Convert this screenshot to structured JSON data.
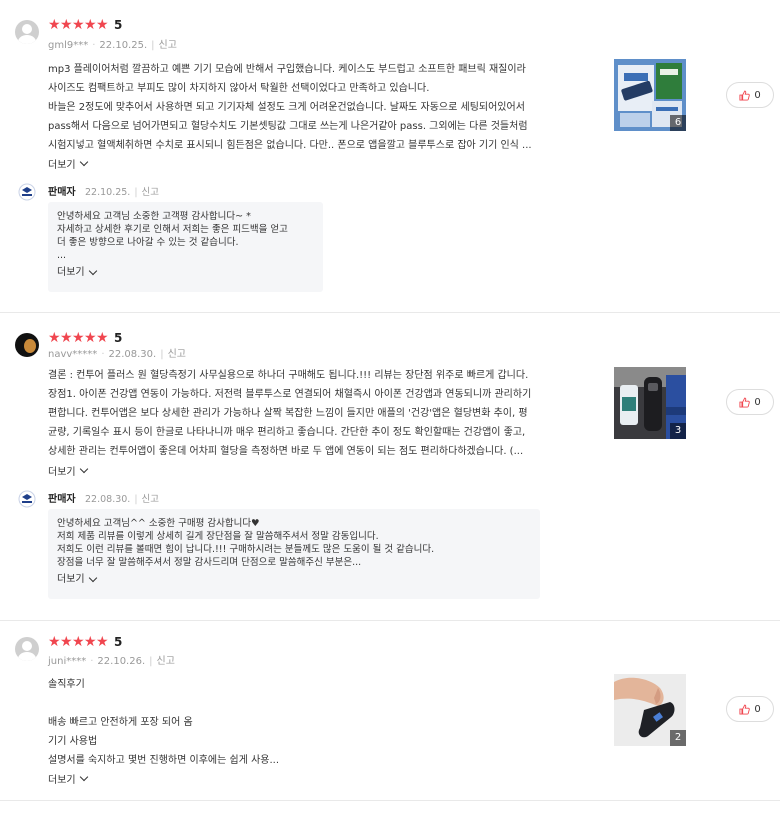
{
  "common": {
    "more_label": "더보기",
    "report_label": "신고"
  },
  "reviews": [
    {
      "rating": "5",
      "user": "gml9***",
      "date": "22.10.25.",
      "content": [
        "mp3 플레이어처럼 깔끔하고 예쁜 기기 모습에 반해서 구입했습니다. 케이스도 부드럽고 소프트한 패브릭 재질이라",
        "사이즈도 컴팩트하고 부피도 많이 차지하지 않아서 탁월한 선택이었다고 만족하고 있습니다.",
        "바늘은 2정도에 맞추어서 사용하면 되고 기기자체 설정도 크게 어려운건없습니다. 날짜도 자동으로 세팅되어있어서",
        "pass해서 다음으로 넘어가면되고 혈당수치도 기본셋팅값 그대로 쓰는게 나은거같아 pass. 그외에는 다른 것들처럼",
        "시험지넣고 혈액체취하면 수치로 표시되니 힘든점은 없습니다. 다만.. 폰으로 앱을깔고 블루투스로 잡아 기기 인식 ..."
      ],
      "image_count": "6",
      "likes": "0",
      "seller_reply": {
        "name": "판매자",
        "date": "22.10.25.",
        "lines": [
          "안녕하세요 고객님 소중한 고객평 감사합니다~ *",
          "자세하고 상세한 후기로 인해서 저희는 좋은 피드백을 얻고",
          "더 좋은 방향으로 나아갈 수 있는 것 같습니다.",
          "..."
        ]
      }
    },
    {
      "rating": "5",
      "user": "navv*****",
      "date": "22.08.30.",
      "content": [
        "결론 : 컨투어 플러스 원 혈당측정기 사무실용으로 하나더 구매해도 됩니다.!!! 리뷰는 장단점 위주로 빠르게 갑니다.",
        "장점1. 아이폰 건강앱 연동이 가능하다. 저전력 블루투스로 연결되어 채혈즉시 아이폰 건강앱과 연동되니까 관리하기",
        "편합니다. 컨투어앱은 보다 상세한 관리가 가능하나 살짝 복잡한 느낌이 들지만 애플의 '건강'앱은 혈당변화 추이, 평",
        "균량, 기록일수 표시 등이 한글로 나타나니까 매우 편리하고 좋습니다. 간단한 추이 정도 확인할때는 건강앱이 좋고,",
        "상세한 관리는 컨투어앱이 좋은데 어차피 혈당을 측정하면 바로 두 앱에 연동이 되는 점도 편리하다하겠습니다. (..."
      ],
      "image_count": "3",
      "likes": "0",
      "seller_reply": {
        "name": "판매자",
        "date": "22.08.30.",
        "lines": [
          "안녕하세요 고객님^^ 소중한 구매평 감사합니다♥",
          "저희 제품 리뷰를 이렇게 상세히 길게 장단점을 잘 말씀해주셔서 정말 감동입니다.",
          "저희도 이런 리뷰를 볼때면 힘이 납니다.!!! 구매하시려는 분들께도 많은 도움이 될 것 같습니다.",
          "장점을 너무 잘 말씀해주셔서 정말 감사드리며 단점으로 말씀해주신 부분은..."
        ]
      }
    },
    {
      "rating": "5",
      "user": "juni****",
      "date": "22.10.26.",
      "content": [
        "솔직후기",
        "",
        "배송 빠르고 안전하게 포장 되어 옴",
        "기기 사용법",
        "설명서를 숙지하고 몇번 진행하면 이후에는 쉽게 사용..."
      ],
      "image_count": "2",
      "likes": "0"
    }
  ]
}
